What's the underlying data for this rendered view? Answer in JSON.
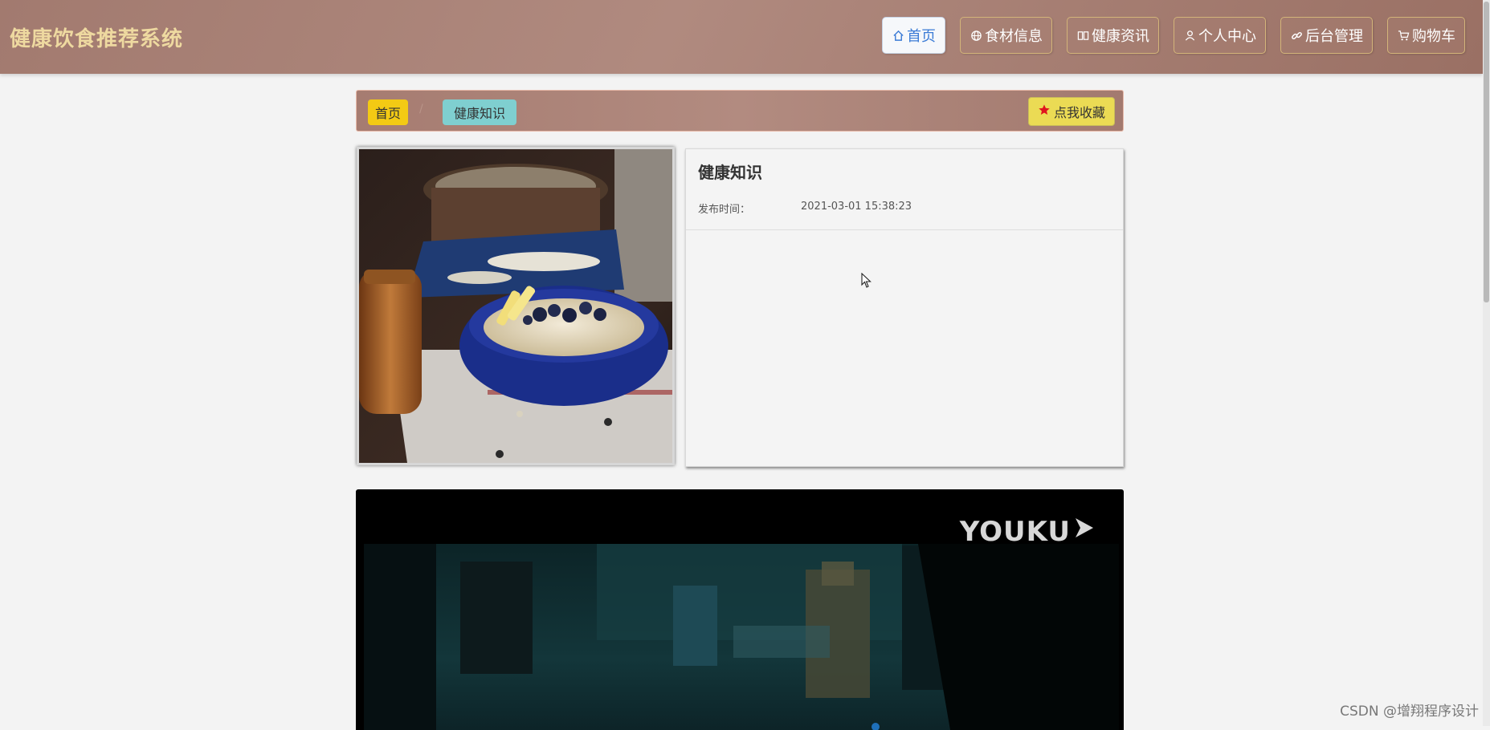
{
  "site": {
    "title": "健康饮食推荐系统"
  },
  "nav": [
    {
      "label": "首页",
      "icon": "home-icon",
      "active": true
    },
    {
      "label": "食材信息",
      "icon": "globe-icon",
      "active": false
    },
    {
      "label": "健康资讯",
      "icon": "book-icon",
      "active": false
    },
    {
      "label": "个人中心",
      "icon": "user-icon",
      "active": false
    },
    {
      "label": "后台管理",
      "icon": "link-icon",
      "active": false
    },
    {
      "label": "购物车",
      "icon": "cart-icon",
      "active": false
    }
  ],
  "breadcrumb": {
    "home": "首页",
    "separator": "/",
    "current": "健康知识"
  },
  "favorite": {
    "label": "点我收藏",
    "icon": "star-icon",
    "icon_color": "#e0141e"
  },
  "article": {
    "title": "健康知识",
    "publish_label": "发布时间：",
    "publish_time": "2021-03-01 15:38:23"
  },
  "video": {
    "logo_text": "YOUKU"
  },
  "watermark": "CSDN @增翔程序设计",
  "colors": {
    "header_bg": "#a9827a",
    "title_color": "#eed9a0",
    "active_nav_text": "#3b7bd6",
    "home_crumb_bg": "#f3ca14",
    "current_crumb_bg": "#7fcfd0",
    "favorite_bg": "#ebdb54"
  }
}
